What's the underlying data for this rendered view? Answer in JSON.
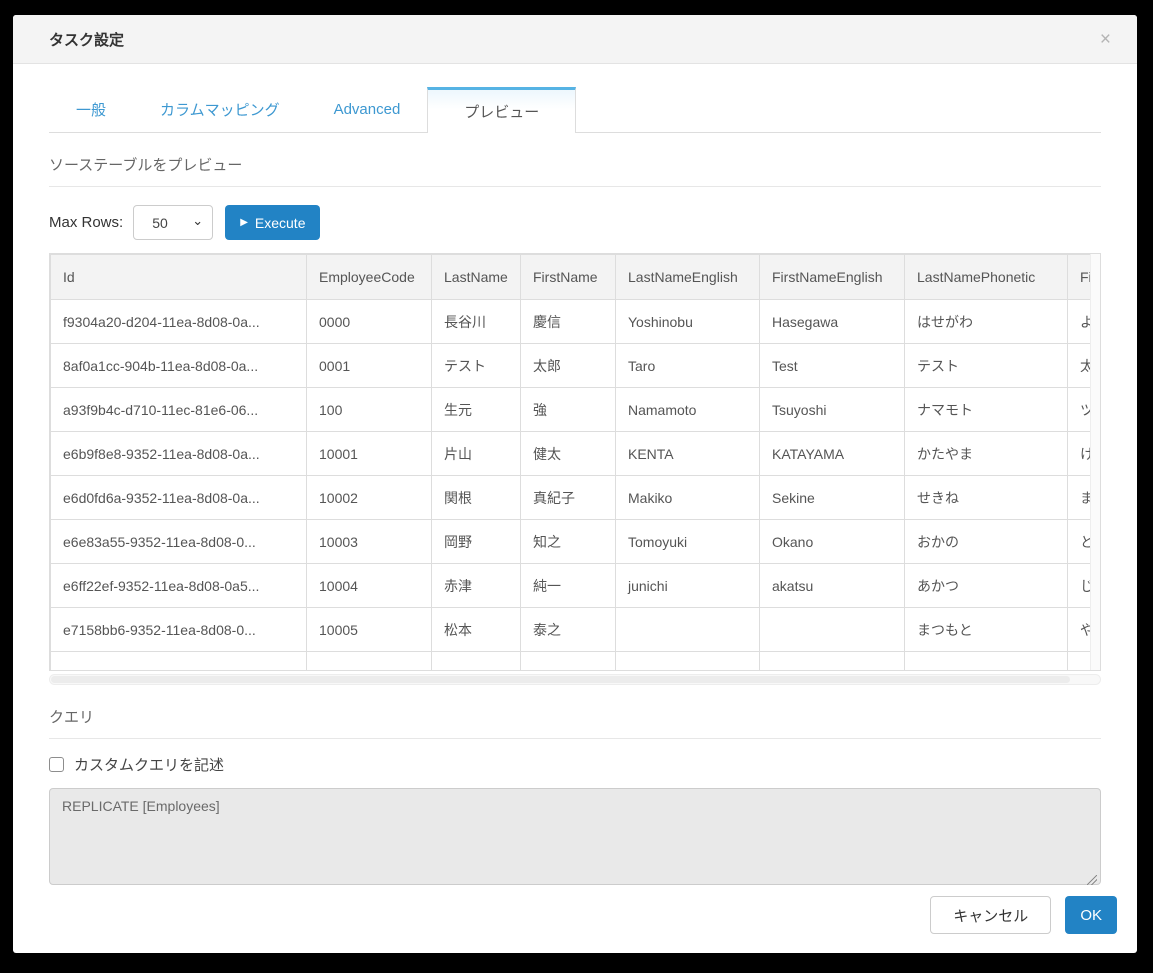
{
  "dialog": {
    "title": "タスク設定",
    "close_icon": "×"
  },
  "tabs": {
    "items": [
      {
        "label": "一般"
      },
      {
        "label": "カラムマッピング"
      },
      {
        "label": "Advanced"
      },
      {
        "label": "プレビュー"
      }
    ],
    "active_index": 3
  },
  "preview_section": {
    "title": "ソーステーブルをプレビュー",
    "max_rows_label": "Max Rows:",
    "max_rows_value": "50",
    "select_chevron_icon": "⌄",
    "execute_button": {
      "play_icon": "▶",
      "label": "Execute"
    }
  },
  "table": {
    "columns": [
      "Id",
      "EmployeeCode",
      "LastName",
      "FirstName",
      "LastNameEnglish",
      "FirstNameEnglish",
      "LastNamePhonetic",
      "FirstNamePhonetic"
    ],
    "rows": [
      [
        "f9304a20-d204-11ea-8d08-0a...",
        "0000",
        "長谷川",
        "慶信",
        "Yoshinobu",
        "Hasegawa",
        "はせがわ",
        "よし"
      ],
      [
        "8af0a1cc-904b-11ea-8d08-0a...",
        "0001",
        "テスト",
        "太郎",
        "Taro",
        "Test",
        "テスト",
        "太郎"
      ],
      [
        "a93f9b4c-d710-11ec-81e6-06...",
        "100",
        "生元",
        "強",
        "Namamoto",
        "Tsuyoshi",
        "ナマモト",
        "ツヨ"
      ],
      [
        "e6b9f8e8-9352-11ea-8d08-0a...",
        "10001",
        "片山",
        "健太",
        "KENTA",
        "KATAYAMA",
        "かたやま",
        "けん"
      ],
      [
        "e6d0fd6a-9352-11ea-8d08-0a...",
        "10002",
        "関根",
        "真紀子",
        "Makiko",
        "Sekine",
        "せきね",
        "まき"
      ],
      [
        "e6e83a55-9352-11ea-8d08-0...",
        "10003",
        "岡野",
        "知之",
        "Tomoyuki",
        "Okano",
        "おかの",
        "とも"
      ],
      [
        "e6ff22ef-9352-11ea-8d08-0a5...",
        "10004",
        "赤津",
        "純一",
        "junichi",
        "akatsu",
        "あかつ",
        "じゅ"
      ],
      [
        "e7158bb6-9352-11ea-8d08-0...",
        "10005",
        "松本",
        "泰之",
        "",
        "",
        "まつもと",
        "やす"
      ],
      [
        "",
        "",
        "",
        "",
        "",
        "",
        "",
        ""
      ]
    ]
  },
  "query_section": {
    "title": "クエリ",
    "checkbox_label": "カスタムクエリを記述",
    "checkbox_checked": false,
    "query_text": "REPLICATE [Employees]"
  },
  "footer": {
    "cancel_label": "キャンセル",
    "ok_label": "OK"
  },
  "colors": {
    "accent_blue": "#2283c5",
    "tab_link_blue": "#3d98d1",
    "active_tab_top_border": "#56b3e4"
  }
}
